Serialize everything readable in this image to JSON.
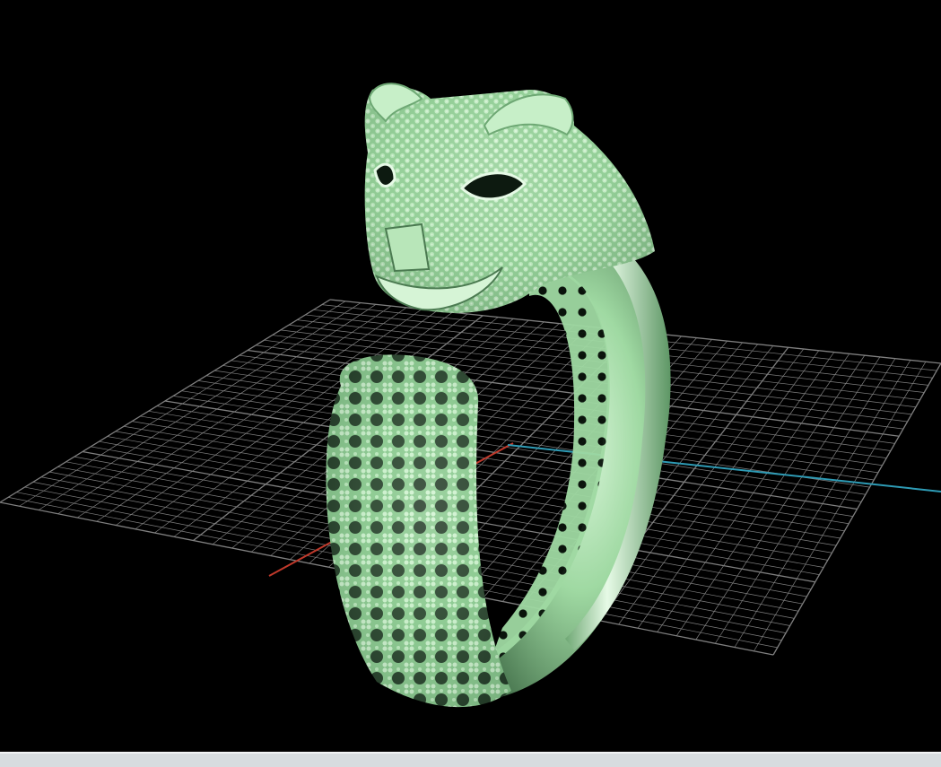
{
  "viewport": {
    "background": "#000000",
    "grid_color": "#7f7f7f",
    "x_axis_color": "#c0392b",
    "y_axis_color": "#2e9bb5"
  },
  "model": {
    "subject": "leopard-head-ring",
    "color": "#9fd9a2",
    "shadow_color": "#3e6a45",
    "highlight_color": "#e6fae6"
  },
  "status_bar": {
    "color": "#d7dcdf"
  }
}
